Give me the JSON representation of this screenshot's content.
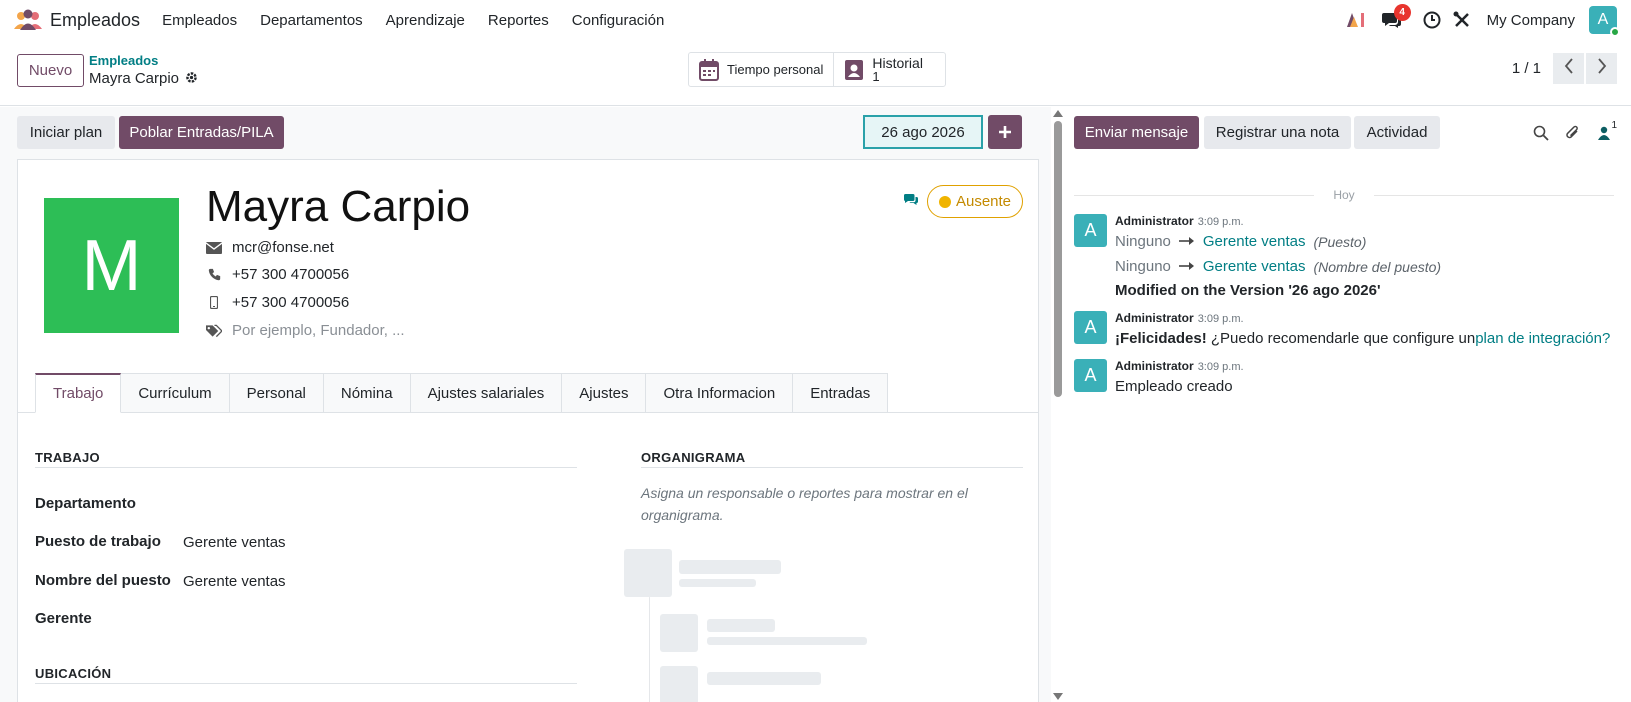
{
  "navbar": {
    "app_name": "Empleados",
    "menu": [
      "Empleados",
      "Departamentos",
      "Aprendizaje",
      "Reportes",
      "Configuración"
    ],
    "messages_badge": "4",
    "company": "My Company",
    "user_initial": "A"
  },
  "control": {
    "new_label": "Nuevo",
    "breadcrumb_parent": "Empleados",
    "breadcrumb_current": "Mayra Carpio",
    "smart_time_off": "Tiempo personal",
    "smart_history_label": "Historial",
    "smart_history_count": "1",
    "pager": "1 / 1"
  },
  "statusbar": {
    "start_plan": "Iniciar plan",
    "populate": "Poblar Entradas/PILA",
    "date": "26 ago 2026"
  },
  "employee": {
    "initial": "M",
    "name": "Mayra Carpio",
    "email": "mcr@fonse.net",
    "work_phone": "+57 300 4700056",
    "mobile_phone": "+57 300 4700056",
    "tags_placeholder": "Por ejemplo, Fundador, ...",
    "presence": "Ausente"
  },
  "tabs": [
    "Trabajo",
    "Currículum",
    "Personal",
    "Nómina",
    "Ajustes salariales",
    "Ajustes",
    "Otra Informacion",
    "Entradas"
  ],
  "work": {
    "section_title": "TRABAJO",
    "department_label": "Departamento",
    "job_position_label": "Puesto de trabajo",
    "job_position_value": "Gerente ventas",
    "job_title_label": "Nombre del puesto",
    "job_title_value": "Gerente ventas",
    "manager_label": "Gerente",
    "location_title": "UBICACIÓN"
  },
  "org": {
    "title": "ORGANIGRAMA",
    "help": "Asigna un responsable o reportes para mostrar en el organigrama."
  },
  "chatter": {
    "send_message": "Enviar mensaje",
    "log_note": "Registrar una nota",
    "activity": "Actividad",
    "followers_count": "1",
    "today": "Hoy",
    "messages": [
      {
        "initial": "A",
        "author": "Administrator",
        "time": "3:09 p.m.",
        "changes": [
          {
            "old": "Ninguno",
            "new": "Gerente ventas",
            "field": "(Puesto)"
          },
          {
            "old": "Ninguno",
            "new": "Gerente ventas",
            "field": "(Nombre del puesto)"
          }
        ],
        "note": "Modified on the Version '26 ago 2026'"
      },
      {
        "initial": "A",
        "author": "Administrator",
        "time": "3:09 p.m.",
        "bold": "¡Felicidades!",
        "text": " ¿Puedo recomendarle que configure un",
        "link": "plan de integración?"
      },
      {
        "initial": "A",
        "author": "Administrator",
        "time": "3:09 p.m.",
        "text": "Empleado creado"
      }
    ]
  },
  "colors": {
    "primary": "#714b67",
    "accent": "#017e84",
    "avatar": "#2dbe56",
    "presence": "#f0b400"
  }
}
